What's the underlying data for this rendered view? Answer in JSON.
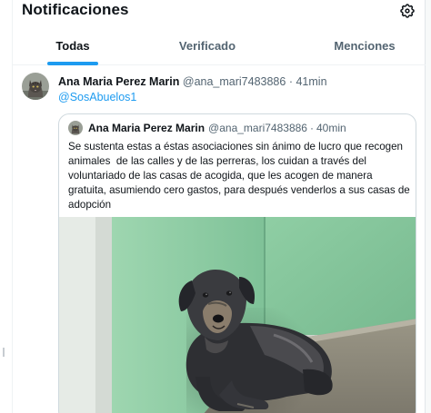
{
  "header": {
    "title": "Notificaciones",
    "settings_icon": "gear-icon"
  },
  "tabs": [
    {
      "label": "Todas",
      "active": true
    },
    {
      "label": "Verificado",
      "active": false
    },
    {
      "label": "Menciones",
      "active": false
    }
  ],
  "notification": {
    "author_name": "Ana Maria Perez Marin",
    "author_handle": "@ana_mari7483886",
    "separator": "·",
    "time": "41min",
    "reply_to": "@SosAbuelos1",
    "quoted": {
      "author_name": "Ana Maria Perez Marin",
      "author_handle": "@ana_mari7483886",
      "separator": "·",
      "time": "40min",
      "text": "Se sustenta estas a éstas asociaciones sin ánimo de lucro que recogen animales  de las calles y de las perreras, los cuidan a través del voluntariado de las casas de acogida, que les acogen de manera gratuita, asumiendo cero gastos, para después venderlos a sus casas de adopción",
      "image_subject": "dog-photo"
    }
  },
  "colors": {
    "accent": "#1d9bf0",
    "text_primary": "#0f1419",
    "text_secondary": "#536471",
    "border": "#cfd9de",
    "wall_green": "#8ccca2"
  }
}
